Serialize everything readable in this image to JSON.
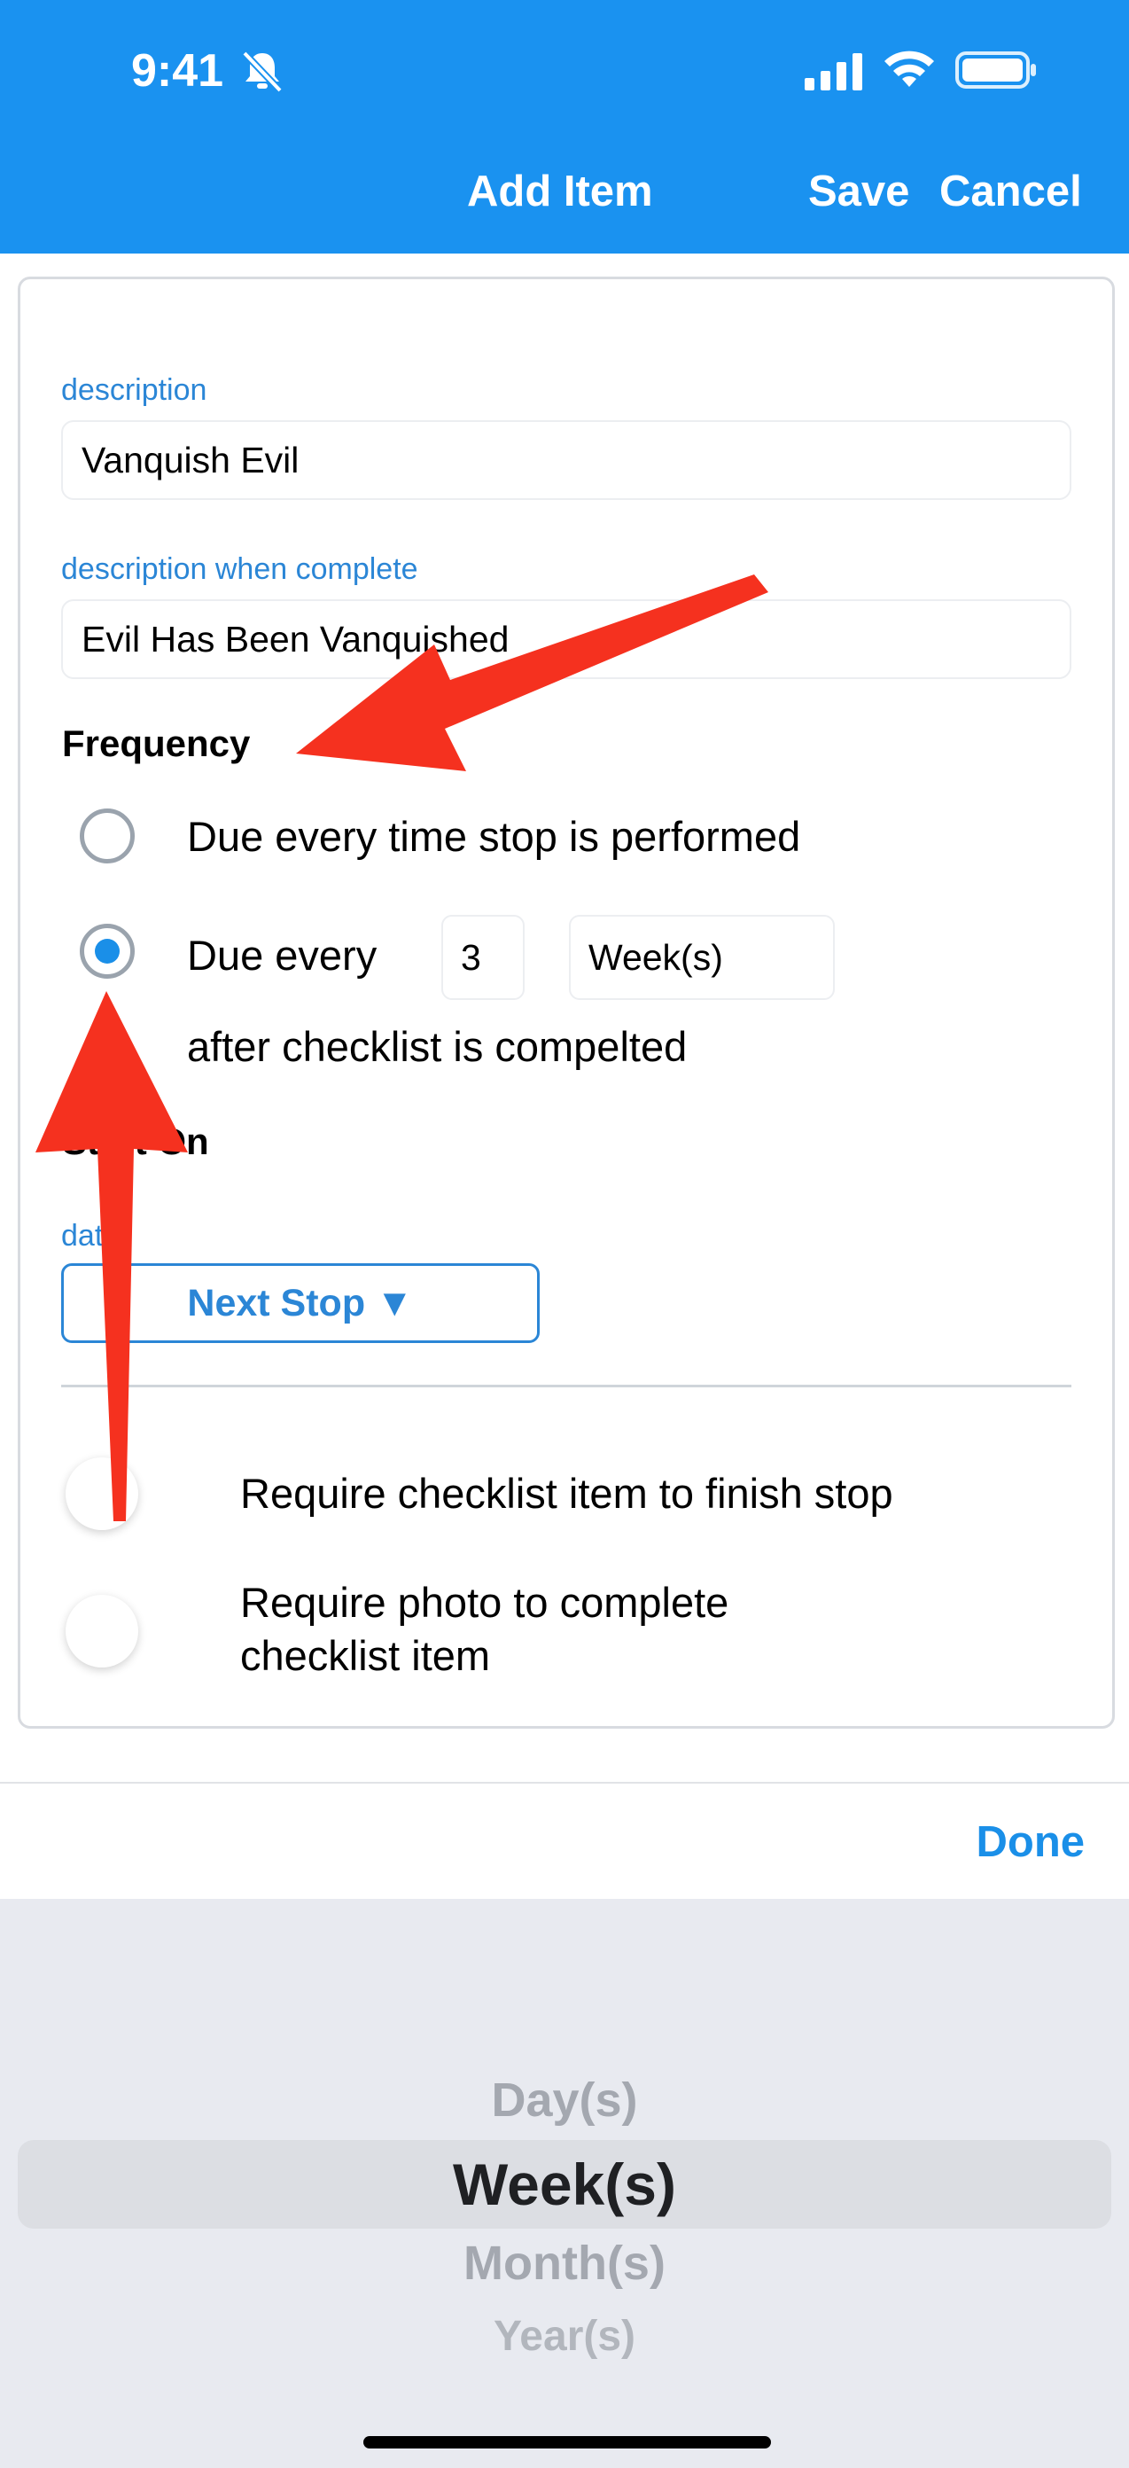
{
  "status_bar": {
    "time": "9:41",
    "bell_icon": "bell-slash-icon",
    "signal_icon": "cellular-signal-icon",
    "wifi_icon": "wifi-icon",
    "battery_icon": "battery-icon"
  },
  "nav": {
    "title": "Add Item",
    "save_label": "Save",
    "cancel_label": "Cancel"
  },
  "form": {
    "description_label": "description",
    "description_value": "Vanquish Evil",
    "complete_label": "description when complete",
    "complete_value": "Evil Has Been Vanquished",
    "frequency_title": "Frequency",
    "option_every_time": "Due every time stop is performed",
    "option_due_every": "Due every",
    "interval_value": "3",
    "interval_unit": "Week(s)",
    "after_text": "after checklist is compelted",
    "start_on_title": "Start On",
    "date_label": "date",
    "start_button": "Next Stop ▼",
    "toggle_finish_label": "Require checklist item to finish stop",
    "toggle_photo_label_line1": "Require photo to complete",
    "toggle_photo_label_line2": "checklist item"
  },
  "picker": {
    "done_label": "Done",
    "options": [
      "Day(s)",
      "Week(s)",
      "Month(s)",
      "Year(s)"
    ],
    "selected": "Week(s)"
  },
  "colors": {
    "header": "#1a92f0",
    "accent": "#2b86d6",
    "arrow": "#f5311f"
  }
}
